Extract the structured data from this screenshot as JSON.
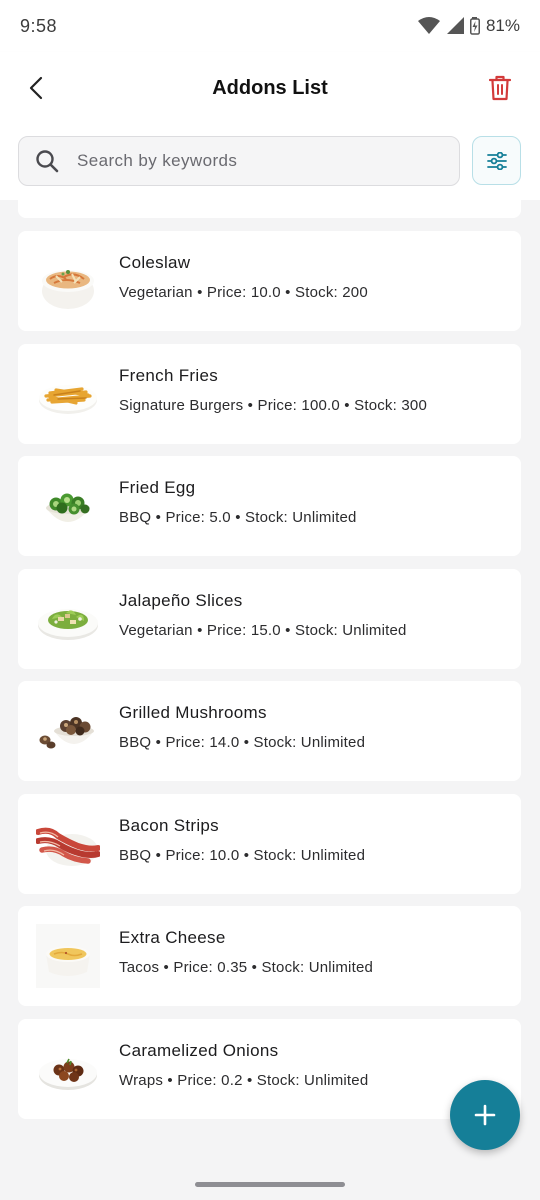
{
  "status_bar": {
    "time": "9:58",
    "battery": "81%"
  },
  "header": {
    "title": "Addons List"
  },
  "search": {
    "placeholder": "Search by keywords"
  },
  "colors": {
    "accent": "#157f98",
    "delete": "#d33b3b"
  },
  "addons": [
    {
      "name": "Coleslaw",
      "meta": "Vegetarian • Price: 10.0 • Stock: 200",
      "image": "coleslaw-bowl"
    },
    {
      "name": "French Fries",
      "meta": "Signature Burgers • Price: 100.0 • Stock: 300",
      "image": "fries-plate"
    },
    {
      "name": "Fried Egg",
      "meta": "BBQ • Price: 5.0 • Stock: Unlimited",
      "image": "green-jalapeno-bowl"
    },
    {
      "name": "Jalapeño Slices",
      "meta": "Vegetarian • Price: 15.0 • Stock: Unlimited",
      "image": "salad-plate"
    },
    {
      "name": "Grilled Mushrooms",
      "meta": "BBQ • Price: 14.0 • Stock: Unlimited",
      "image": "mushroom-bowl"
    },
    {
      "name": "Bacon Strips",
      "meta": "BBQ • Price: 10.0 • Stock: Unlimited",
      "image": "bacon-plate"
    },
    {
      "name": "Extra Cheese",
      "meta": "Tacos • Price: 0.35 • Stock: Unlimited",
      "image": "cheese-bowl"
    },
    {
      "name": "Caramelized Onions",
      "meta": "Wraps • Price: 0.2 • Stock: Unlimited",
      "image": "onion-plate"
    }
  ]
}
